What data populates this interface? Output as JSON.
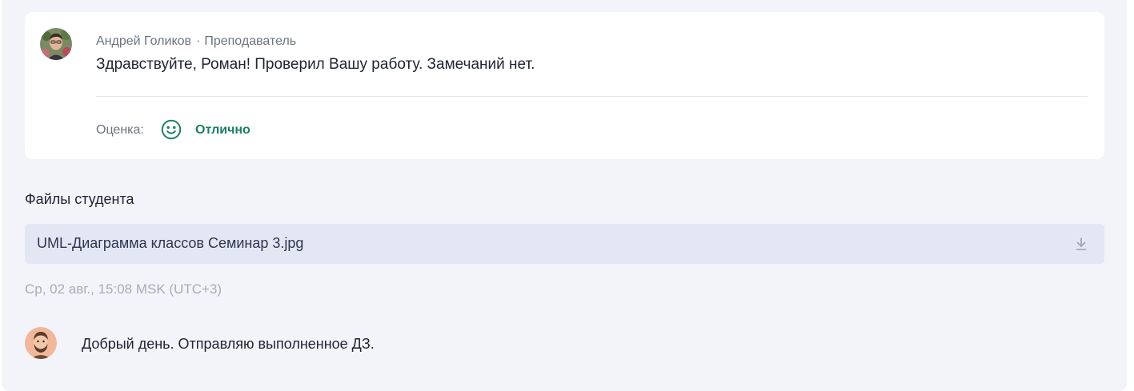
{
  "review": {
    "author_name": "Андрей Голиков",
    "separator": "·",
    "author_role": "Преподаватель",
    "comment": "Здравствуйте, Роман! Проверил Вашу работу. Замечаний нет.",
    "grade_label": "Оценка:",
    "grade_value": "Отлично",
    "grade_icon": "smile-icon",
    "grade_color": "#1a7f64"
  },
  "files": {
    "title": "Файлы студента",
    "items": [
      {
        "name": "UML-Диаграмма классов Семинар 3.jpg",
        "icon": "download-icon"
      }
    ]
  },
  "message": {
    "timestamp": "Ср, 02 авг., 15:08 MSK (UTC+3)",
    "text": "Добрый день. Отправляю выполненное ДЗ."
  }
}
